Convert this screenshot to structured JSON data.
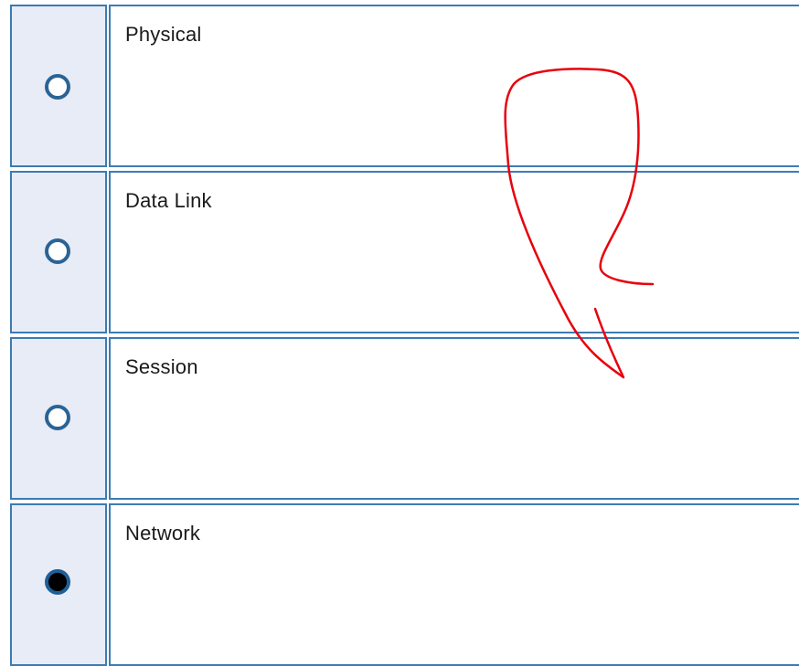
{
  "options": [
    {
      "label": "Physical",
      "selected": false
    },
    {
      "label": "Data Link",
      "selected": false
    },
    {
      "label": "Session",
      "selected": false
    },
    {
      "label": "Network",
      "selected": true
    }
  ],
  "colors": {
    "border": "#3d7bb3",
    "radio_cell_bg": "#e8ecf6",
    "radio_ring": "#2a6496",
    "annotation_stroke": "#e8000b"
  }
}
